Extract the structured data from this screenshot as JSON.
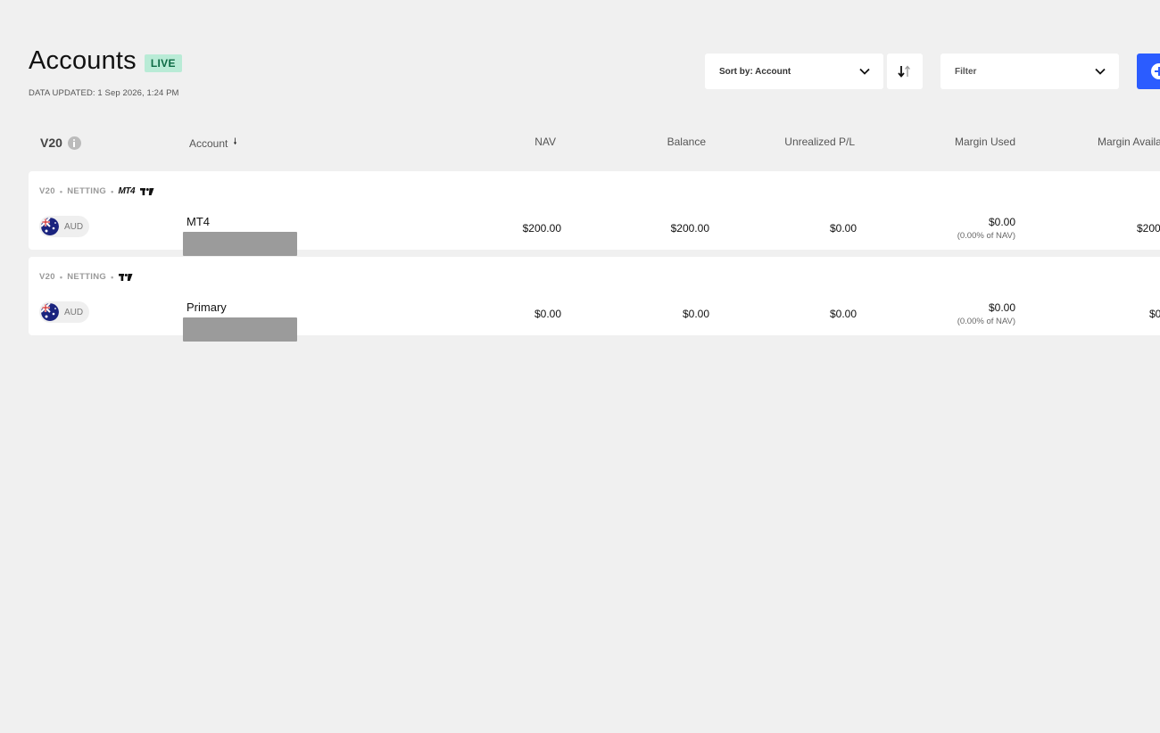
{
  "header": {
    "title": "Accounts",
    "badge": "LIVE",
    "data_updated": "DATA UPDATED: 1 Sep 2026, 1:24 PM"
  },
  "controls": {
    "sort_label": "Sort by: Account",
    "filter_label": "Filter",
    "sort_direction_icon": "sort-arrows-icon",
    "add_icon": "plus-circle-icon"
  },
  "columns": {
    "group": "V20",
    "account": "Account",
    "nav": "NAV",
    "balance": "Balance",
    "unrealized": "Unrealized P/L",
    "margin_used": "Margin Used",
    "margin_available": "Margin Availa"
  },
  "accounts": [
    {
      "platform": "V20",
      "mode": "NETTING",
      "integrations": [
        "MT4",
        "TradingView"
      ],
      "currency": "AUD",
      "name": "MT4",
      "nav": "$200.00",
      "balance": "$200.00",
      "unrealized": "$0.00",
      "margin_used": "$0.00",
      "margin_used_pct": "(0.00% of NAV)",
      "margin_available": "$200"
    },
    {
      "platform": "V20",
      "mode": "NETTING",
      "integrations": [
        "TradingView"
      ],
      "currency": "AUD",
      "name": "Primary",
      "nav": "$0.00",
      "balance": "$0.00",
      "unrealized": "$0.00",
      "margin_used": "$0.00",
      "margin_used_pct": "(0.00% of NAV)",
      "margin_available": "$0"
    }
  ],
  "colors": {
    "background": "#f0f0f0",
    "badge_bg": "#b9ebd6",
    "badge_text": "#0d6a44",
    "primary": "#2b5cff"
  }
}
